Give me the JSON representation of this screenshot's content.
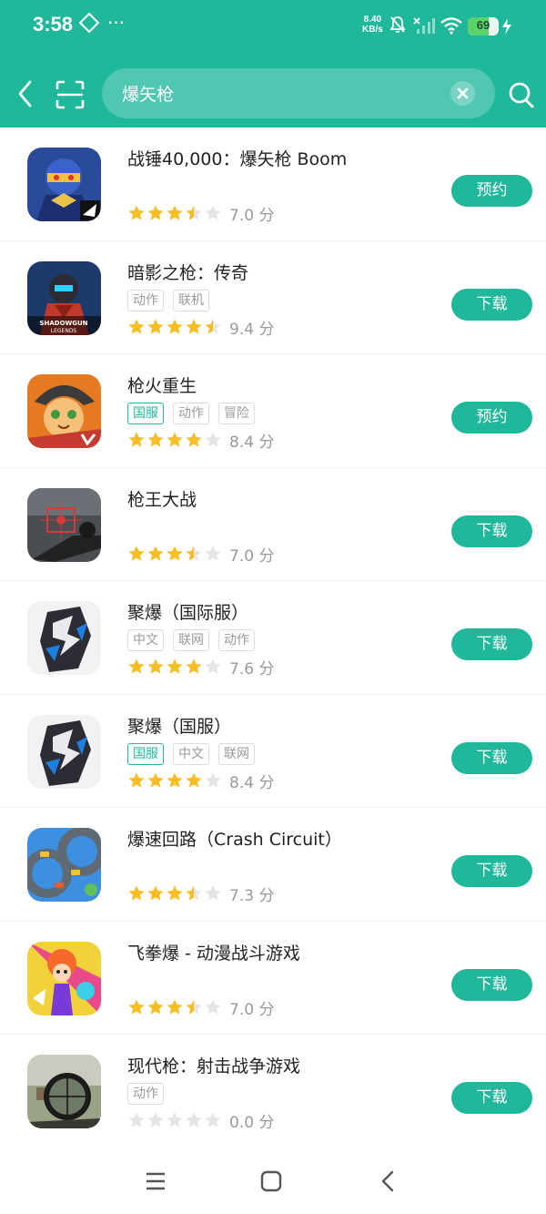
{
  "status": {
    "time": "3:58",
    "dots": "···",
    "net_speed_value": "8.40",
    "net_speed_unit": "KB/s",
    "battery": "69",
    "battery_level": 0.69
  },
  "search": {
    "value": "爆矢枪"
  },
  "colors": {
    "accent": "#1fb89a",
    "star": "#f8bd23",
    "star_empty": "#e5e5e5"
  },
  "results": [
    {
      "title": "战锤40,000：爆矢枪 Boom",
      "tags": [],
      "stars": [
        1,
        1,
        1,
        0.5,
        0
      ],
      "score": "7.0 分",
      "button": "预约",
      "icon": "space-marine-icon"
    },
    {
      "title": "暗影之枪：传奇",
      "tags": [
        {
          "label": "动作"
        },
        {
          "label": "联机"
        }
      ],
      "stars": [
        1,
        1,
        1,
        1,
        0.5
      ],
      "score": "9.4 分",
      "button": "下载",
      "icon": "shadowgun-legends-icon"
    },
    {
      "title": "枪火重生",
      "tags": [
        {
          "label": "国服",
          "green": true
        },
        {
          "label": "动作"
        },
        {
          "label": "冒险"
        }
      ],
      "stars": [
        1,
        1,
        1,
        1,
        0
      ],
      "score": "8.4 分",
      "button": "预约",
      "icon": "cat-gunslinger-icon"
    },
    {
      "title": "枪王大战",
      "tags": [],
      "stars": [
        1,
        1,
        1,
        0.5,
        0
      ],
      "score": "7.0 分",
      "button": "下载",
      "icon": "sniper-scope-icon"
    },
    {
      "title": "聚爆（国际服）",
      "tags": [
        {
          "label": "中文"
        },
        {
          "label": "联网"
        },
        {
          "label": "动作"
        }
      ],
      "stars": [
        1,
        1,
        1,
        1,
        0
      ],
      "score": "7.6 分",
      "button": "下载",
      "icon": "implosion-mech-icon"
    },
    {
      "title": "聚爆（国服）",
      "tags": [
        {
          "label": "国服",
          "green": true
        },
        {
          "label": "中文"
        },
        {
          "label": "联网"
        }
      ],
      "stars": [
        1,
        1,
        1,
        1,
        0
      ],
      "score": "8.4 分",
      "button": "下载",
      "icon": "implosion-mech-icon"
    },
    {
      "title": "爆速回路（Crash Circuit）",
      "tags": [],
      "stars": [
        1,
        1,
        1,
        0.5,
        0
      ],
      "score": "7.3 分",
      "button": "下载",
      "icon": "crash-circuit-icon"
    },
    {
      "title": "飞拳爆 - 动漫战斗游戏",
      "tags": [],
      "stars": [
        1,
        1,
        1,
        0.5,
        0
      ],
      "score": "7.0 分",
      "button": "下载",
      "icon": "anime-fighter-icon"
    },
    {
      "title": "现代枪：射击战争游戏",
      "tags": [
        {
          "label": "动作"
        }
      ],
      "stars": [
        0,
        0,
        0,
        0,
        0
      ],
      "score": "0.0 分",
      "button": "下载",
      "icon": "rifle-scope-icon"
    }
  ]
}
